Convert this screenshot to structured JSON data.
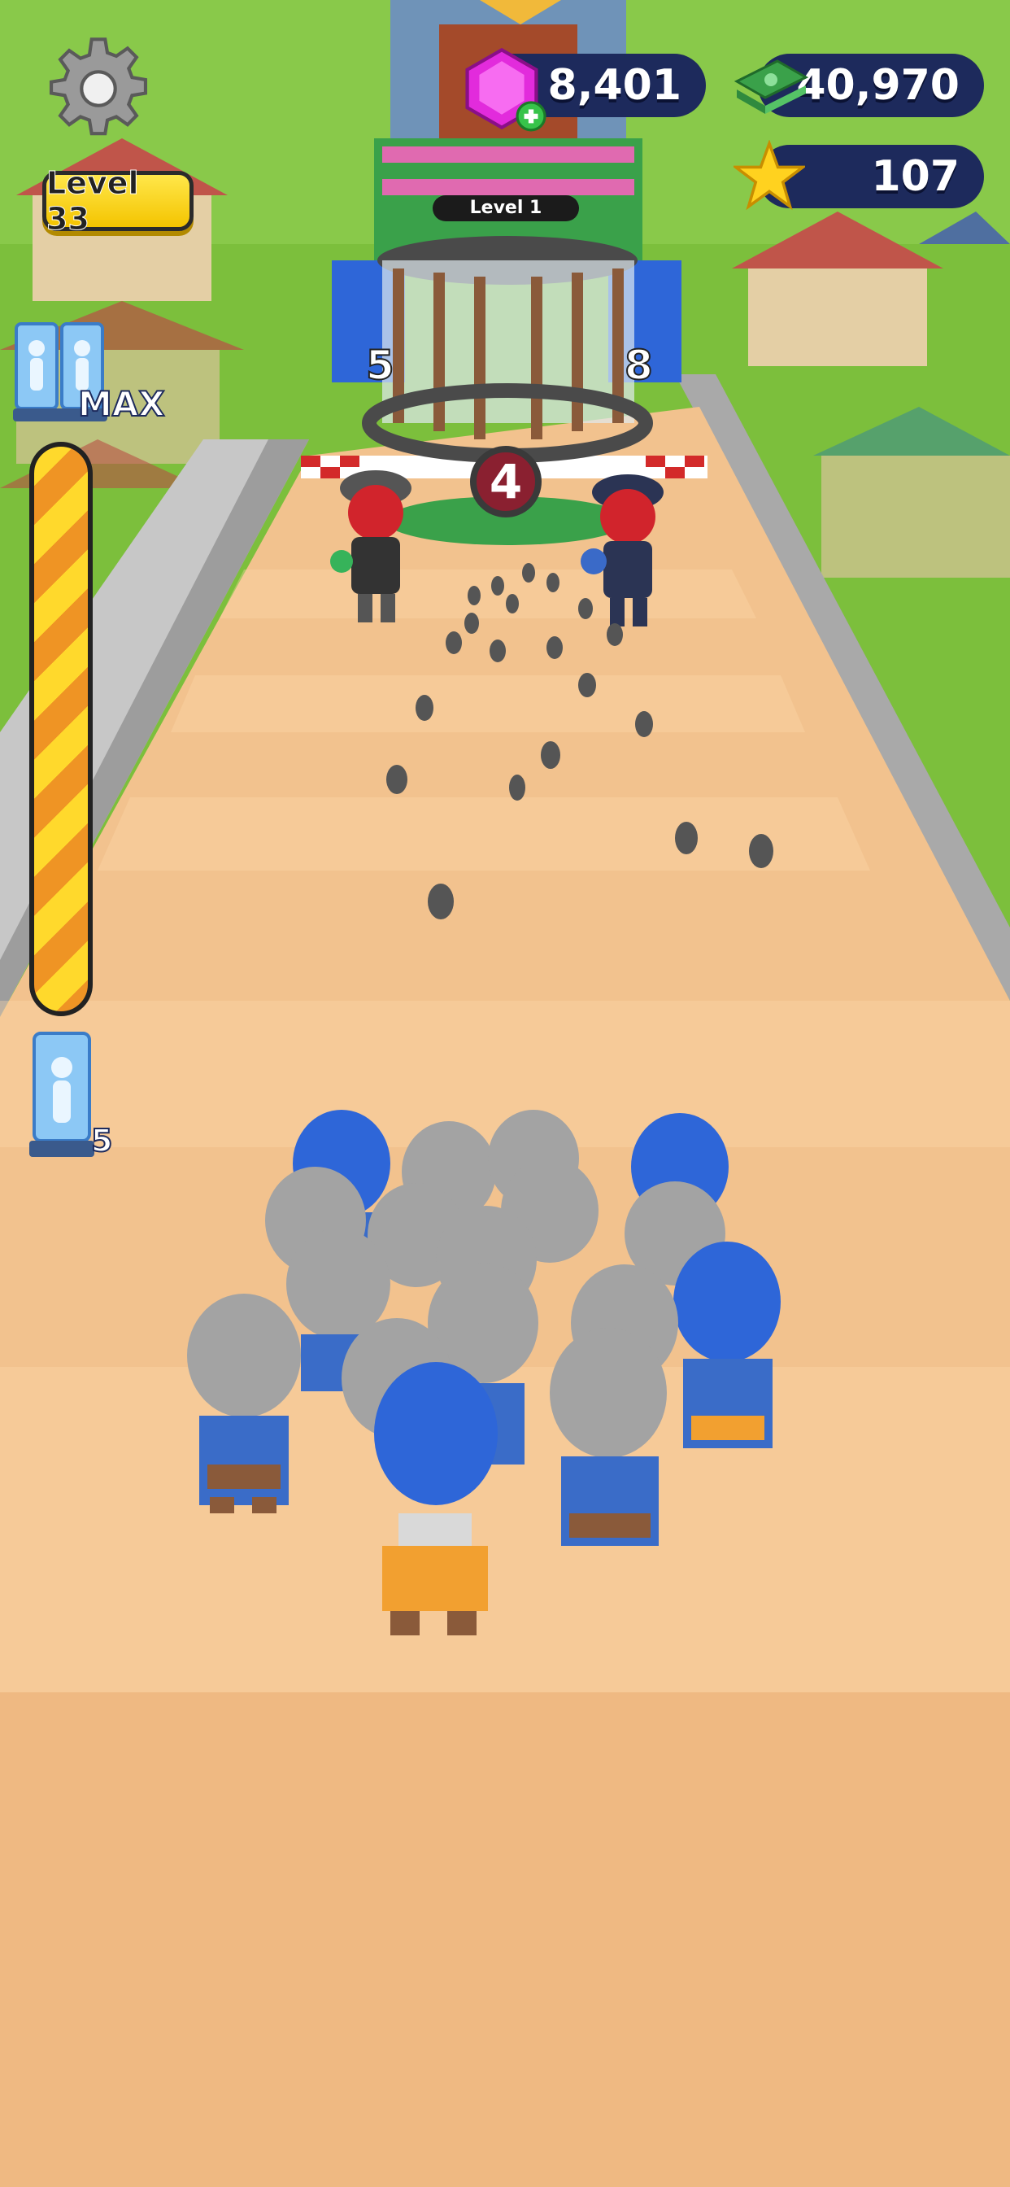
{
  "hud": {
    "gems": "8,401",
    "cash": "40,970",
    "stars": "107",
    "level": "Level 33",
    "settings_icon": "gear-icon",
    "gem_icon": "gem-add-icon",
    "cash_icon": "cash-stack-icon",
    "star_icon": "star-icon"
  },
  "army": {
    "upgrade_status": "MAX",
    "recruit_count": "5",
    "power_fill": 1.0
  },
  "enemy_gate": {
    "label": "Level 1",
    "left_number": "5",
    "right_number": "8",
    "cage_count": "4"
  },
  "colors": {
    "grass": "#7cbf3c",
    "track": "#f2c28e",
    "hud_pill": "#1d2a5c",
    "level_badge": "#ffd92c",
    "power_stripe_a": "#ffd92c",
    "power_stripe_b": "#ef9424",
    "team_blue": "#2e66d8",
    "enemy_red": "#d1242c"
  }
}
